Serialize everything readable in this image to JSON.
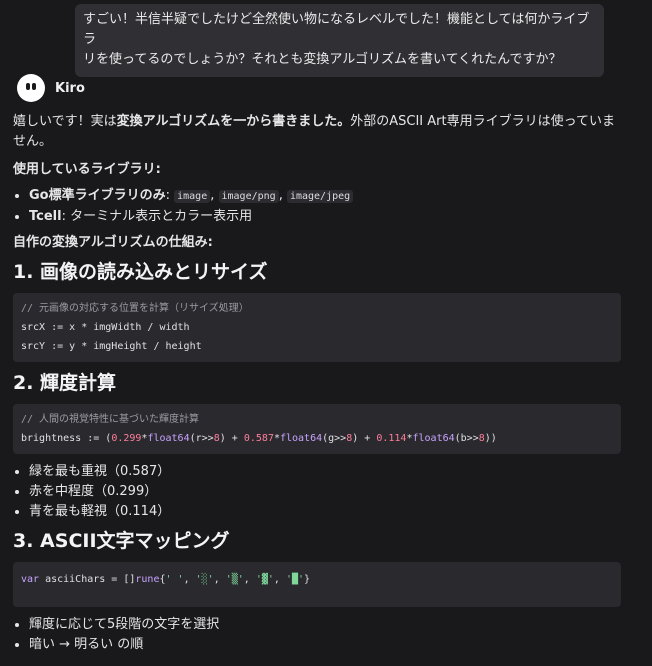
{
  "user_message": {
    "line1": "すごい！半信半疑でしたけど全然使い物になるレベルでした！機能としては何かライブラ",
    "line2": "リを使ってるのでしょうか？それとも変換アルゴリズムを書いてくれたんですか？"
  },
  "agent": {
    "name": "Kiro"
  },
  "response": {
    "intro_pre": "嬉しいです！実は",
    "intro_bold": "変換アルゴリズムを一から書きました。",
    "intro_post": "外部のASCII Art専用ライブラリは使っていま",
    "intro_line2": "せん。",
    "libs_heading": "使用しているライブラリ:",
    "libs": [
      {
        "bold": "Go標準ライブラリのみ",
        "sep": ": ",
        "codes": [
          "image",
          "image/png",
          "image/jpeg"
        ]
      },
      {
        "bold": "Tcell",
        "text": ": ターミナル表示とカラー表示用"
      }
    ],
    "algo_heading": "自作の変換アルゴリズムの仕組み:",
    "section1": {
      "title": "1. 画像の読み込みとリサイズ",
      "code_comment": "// 元画像の対応する位置を計算（リサイズ処理）",
      "code_line1": "srcX := x * imgWidth / width",
      "code_line2": "srcY := y * imgHeight / height"
    },
    "section2": {
      "title": "2. 輝度計算",
      "code_comment": "// 人間の視覚特性に基づいた輝度計算",
      "code_parts": [
        "brightness := (",
        "0.299",
        "*",
        "float64",
        "(r>>",
        "8",
        ") + ",
        "0.587",
        "*",
        "float64",
        "(g>>",
        "8",
        ") + ",
        "0.114",
        "*",
        "float64",
        "(b>>",
        "8",
        "))"
      ],
      "bullets": [
        "緑を最も重視（0.587）",
        "赤を中程度（0.299）",
        "青を最も軽視（0.114）"
      ]
    },
    "section3": {
      "title": "3. ASCII文字マッピング",
      "code_parts": [
        "var",
        " asciiChars = []",
        "rune",
        "{",
        "' '",
        ", ",
        "'░'",
        ", ",
        "'▒'",
        ", ",
        "'▓'",
        ", ",
        "'█'",
        "}"
      ],
      "bullets": [
        "輝度に応じて5段階の文字を選択",
        "暗い → 明るい の順"
      ]
    }
  }
}
